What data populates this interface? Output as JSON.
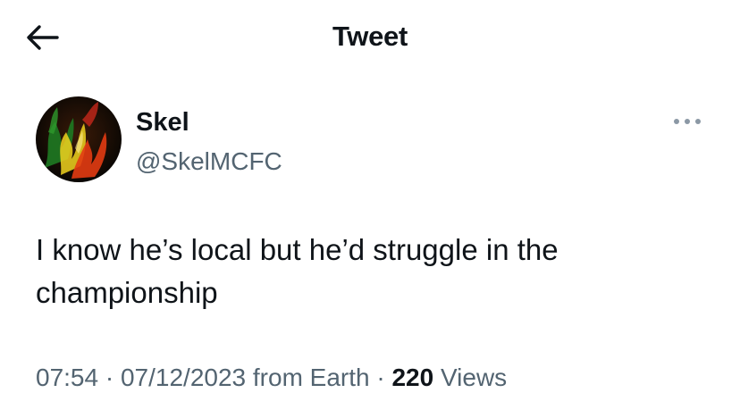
{
  "header": {
    "title": "Tweet",
    "back_icon": "arrow-left-icon"
  },
  "author": {
    "display_name": "Skel",
    "handle": "@SkelMCFC",
    "avatar_icon": "flame-avatar-image",
    "avatar_colors": [
      "#1e7a22",
      "#f0d21e",
      "#e23b12",
      "#0b0b06"
    ]
  },
  "more_icon": "more-horizontal-icon",
  "tweet": {
    "lines": [
      "I know he’s local but he’d struggle in the",
      "championship"
    ]
  },
  "meta": {
    "time": "07:54",
    "separator1": "·",
    "date": "07/12/2023",
    "source": "from Earth",
    "separator2": "·",
    "views_count": "220",
    "views_label": "Views"
  },
  "colors": {
    "text_primary": "#0f1419",
    "text_secondary": "#536471",
    "icon_muted": "#8b98a5",
    "background": "#ffffff"
  }
}
